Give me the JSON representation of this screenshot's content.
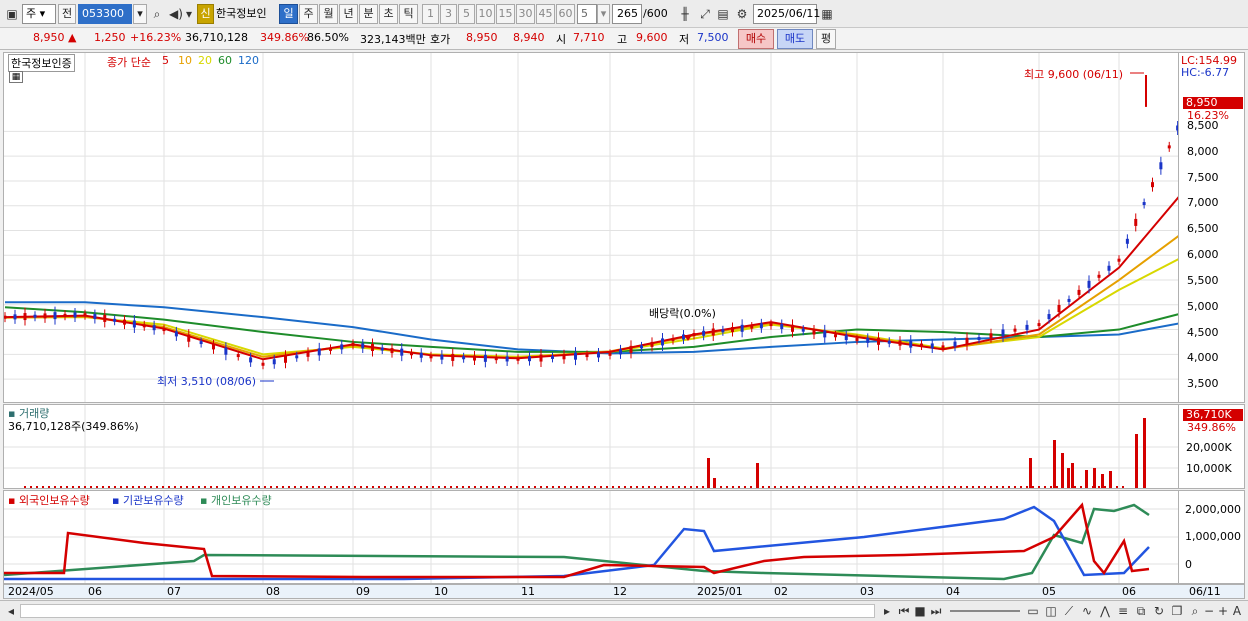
{
  "toolbar": {
    "type_select": "주",
    "prev_label": "전",
    "code": "053300",
    "new_badge": "신",
    "stock_name": "한국정보인",
    "periods": [
      "일",
      "주",
      "월",
      "년",
      "분",
      "초",
      "틱"
    ],
    "active_period": "일",
    "minutes": [
      "1",
      "3",
      "5",
      "10",
      "15",
      "30",
      "45",
      "60"
    ],
    "minute_value": "5",
    "count": "265",
    "count_max": "/600",
    "date": "2025/06/11"
  },
  "quote": {
    "price": "8,950",
    "arrow": "▲",
    "change": "1,250",
    "change_pct": "+16.23%",
    "volume": "36,710,128",
    "vol_ratio": "349.86%",
    "turnover": "86.50%",
    "amount": "323,143백만",
    "hoga_label": "호가",
    "ask": "8,950",
    "bid": "8,940",
    "open_label": "시",
    "open": "7,710",
    "high_label": "고",
    "high": "9,600",
    "low_label": "저",
    "low": "7,500",
    "buy_label": "매수",
    "sell_label": "매도",
    "eval_label": "평"
  },
  "legend": {
    "name": "한국정보인증",
    "main_label": "종가 단순",
    "ma": [
      {
        "label": "5",
        "color": "#d40000"
      },
      {
        "label": "10",
        "color": "#e6a000"
      },
      {
        "label": "20",
        "color": "#d8d800"
      },
      {
        "label": "60",
        "color": "#1e8c2a"
      },
      {
        "label": "120",
        "color": "#1a6bc8"
      }
    ]
  },
  "price_axis": {
    "lc": "LC:154.99",
    "hc": "HC:-6.77",
    "ticks": [
      "8,500",
      "8,000",
      "7,500",
      "7,000",
      "6,500",
      "6,000",
      "5,500",
      "5,000",
      "4,500",
      "4,000",
      "3,500"
    ],
    "current_tag": "8,950",
    "current_pct": "16.23%"
  },
  "annotations": {
    "high": "최고 9,600 (06/11)",
    "low": "최저 3,510 (08/06)",
    "dividend": "배당락(0.0%)"
  },
  "volume_panel": {
    "title": "거래량",
    "value": "36,710,128주(349.86%)",
    "tag": "36,710K",
    "pct": "349.86%",
    "ticks": [
      "20,000K",
      "10,000K"
    ]
  },
  "holdings_panel": {
    "series": [
      {
        "label": "외국인보유수량",
        "color": "#d40000"
      },
      {
        "label": "기관보유수량",
        "color": "#1a34c8"
      },
      {
        "label": "개인보유수량",
        "color": "#2e8b57"
      }
    ],
    "ticks": [
      "2,000,000",
      "1,000,000",
      "0"
    ]
  },
  "x_axis": [
    "2024/05",
    "06",
    "07",
    "08",
    "09",
    "10",
    "11",
    "12",
    "2025/01",
    "02",
    "03",
    "04",
    "05",
    "06",
    "06/11"
  ],
  "chart_data": {
    "type": "line",
    "title": "한국정보인증",
    "x": [
      "2024/05",
      "06",
      "07",
      "08",
      "09",
      "10",
      "11",
      "12",
      "2025/01",
      "02",
      "03",
      "04",
      "05",
      "06",
      "06/11"
    ],
    "ylim": [
      3300,
      9800
    ],
    "series": [
      {
        "name": "종가",
        "values": [
          4750,
          4800,
          4500,
          3800,
          4200,
          3950,
          3900,
          4000,
          4400,
          4600,
          4300,
          4150,
          4600,
          5900,
          8950
        ]
      },
      {
        "name": "5",
        "values": [
          4750,
          4780,
          4520,
          3900,
          4200,
          3980,
          3920,
          4050,
          4400,
          4650,
          4350,
          4100,
          4500,
          5750,
          7350
        ]
      },
      {
        "name": "10",
        "values": [
          4740,
          4760,
          4550,
          3950,
          4180,
          3990,
          3930,
          4060,
          4380,
          4630,
          4380,
          4100,
          4400,
          5500,
          6500
        ]
      },
      {
        "name": "20",
        "values": [
          4740,
          4750,
          4600,
          4000,
          4150,
          4000,
          3950,
          4050,
          4320,
          4600,
          4400,
          4120,
          4350,
          5300,
          6000
        ]
      },
      {
        "name": "60",
        "values": [
          4950,
          4850,
          4700,
          4450,
          4250,
          4150,
          4050,
          4050,
          4150,
          4350,
          4500,
          4450,
          4350,
          4500,
          4850
        ]
      },
      {
        "name": "120",
        "values": [
          5050,
          5050,
          4950,
          4750,
          4550,
          4300,
          4100,
          4020,
          4050,
          4150,
          4250,
          4300,
          4350,
          4400,
          4650
        ]
      }
    ],
    "high": {
      "date": "06/11",
      "value": 9600
    },
    "low": {
      "date": "08/06",
      "value": 3510
    }
  }
}
